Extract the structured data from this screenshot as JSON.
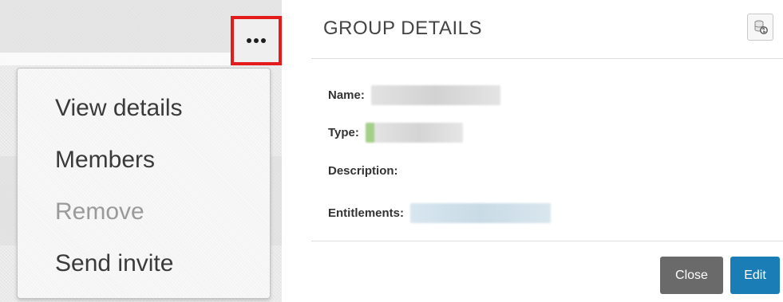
{
  "left_panel": {
    "more_button_icon": "more-horizontal-icon",
    "highlight_color": "#e41b1b",
    "menu_items": [
      {
        "label": "View details",
        "disabled": false
      },
      {
        "label": "Members",
        "disabled": false
      },
      {
        "label": "Remove",
        "disabled": true
      },
      {
        "label": "Send invite",
        "disabled": false
      }
    ]
  },
  "group_details": {
    "title": "GROUP DETAILS",
    "refresh_icon": "database-refresh-icon",
    "fields": {
      "name_label": "Name:",
      "type_label": "Type:",
      "description_label": "Description:",
      "entitlements_label": "Entitlements:"
    },
    "buttons": {
      "close_label": "Close",
      "edit_label": "Edit"
    },
    "colors": {
      "close": "#6a6a6a",
      "edit": "#1a7db5"
    }
  }
}
